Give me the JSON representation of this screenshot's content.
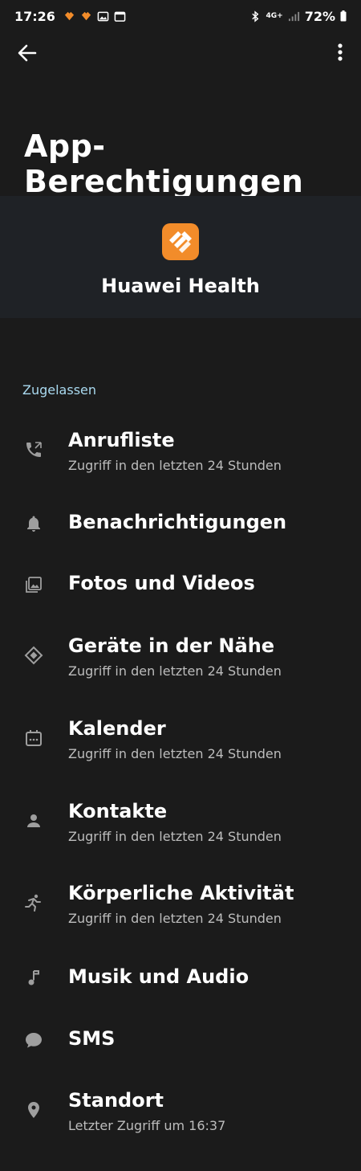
{
  "status_bar": {
    "time": "17:26",
    "network": "4G+",
    "battery": "72%"
  },
  "page": {
    "title": "App-Berechtigungen"
  },
  "app": {
    "name": "Huawei Health",
    "icon_color": "#f28c2a"
  },
  "section": {
    "label": "Zugelassen"
  },
  "permissions": [
    {
      "label": "Anrufliste",
      "subtitle": "Zugriff in den letzten 24 Stunden",
      "icon": "call-log-icon"
    },
    {
      "label": "Benachrichtigungen",
      "subtitle": "",
      "icon": "bell-icon"
    },
    {
      "label": "Fotos und Videos",
      "subtitle": "",
      "icon": "photos-icon"
    },
    {
      "label": "Geräte in der Nähe",
      "subtitle": "Zugriff in den letzten 24 Stunden",
      "icon": "nearby-devices-icon"
    },
    {
      "label": "Kalender",
      "subtitle": "Zugriff in den letzten 24 Stunden",
      "icon": "calendar-icon"
    },
    {
      "label": "Kontakte",
      "subtitle": "Zugriff in den letzten 24 Stunden",
      "icon": "person-icon"
    },
    {
      "label": "Körperliche Aktivität",
      "subtitle": "Zugriff in den letzten 24 Stunden",
      "icon": "activity-icon"
    },
    {
      "label": "Musik und Audio",
      "subtitle": "",
      "icon": "music-note-icon"
    },
    {
      "label": "SMS",
      "subtitle": "",
      "icon": "chat-bubble-icon"
    },
    {
      "label": "Standort",
      "subtitle": "Letzter Zugriff um 16:37",
      "icon": "location-pin-icon"
    }
  ]
}
